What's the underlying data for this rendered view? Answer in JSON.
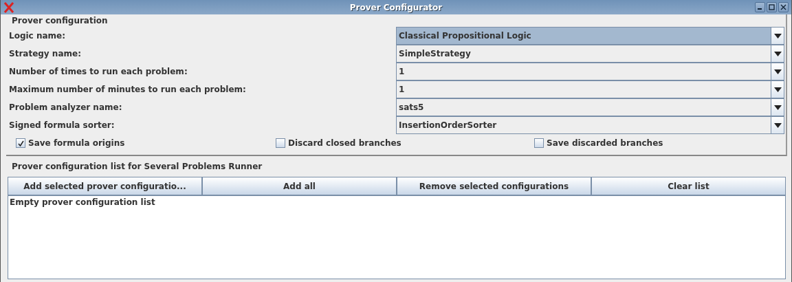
{
  "window": {
    "title": "Prover Configurator"
  },
  "configuration": {
    "title": "Prover configuration",
    "fields": [
      {
        "label": "Logic name:",
        "value": "Classical Propositional Logic",
        "focused": true
      },
      {
        "label": "Strategy name:",
        "value": "SimpleStrategy",
        "focused": false
      },
      {
        "label": "Number of times to run each problem:",
        "value": "1",
        "focused": false
      },
      {
        "label": "Maximum number of minutes to run each problem:",
        "value": "1",
        "focused": false
      },
      {
        "label": "Problem analyzer name:",
        "value": "sats5",
        "focused": false
      },
      {
        "label": "Signed formula sorter:",
        "value": "InsertionOrderSorter",
        "focused": false
      }
    ],
    "options": [
      {
        "label": "Save formula origins",
        "checked": true
      },
      {
        "label": "Discard closed branches",
        "checked": false
      },
      {
        "label": "Save discarded branches",
        "checked": false
      }
    ]
  },
  "list_panel": {
    "title": "Prover configuration list for Several Problems Runner",
    "buttons": [
      "Add selected prover configuratio...",
      "Add all",
      "Remove selected configurations",
      "Clear list"
    ],
    "list_message": "Empty prover configuration list"
  }
}
